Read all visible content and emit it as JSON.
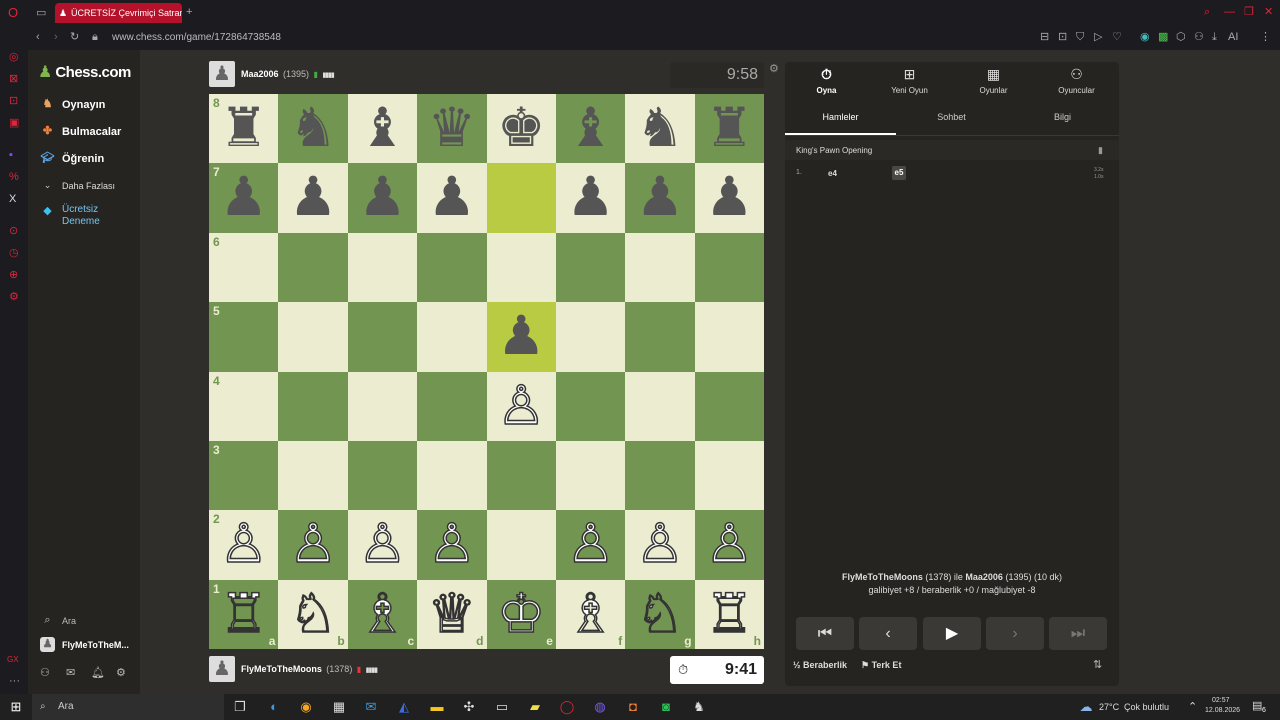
{
  "browser": {
    "tab_title": "ÜCRETSİZ Çevrimiçi Satranç",
    "url": "www.chess.com/game/172864738548",
    "ai_label": "AI"
  },
  "sidebar": {
    "logo": "Chess.com",
    "items": [
      {
        "label": "Oynayın",
        "icon": "play-icon"
      },
      {
        "label": "Bulmacalar",
        "icon": "puzzle-icon"
      },
      {
        "label": "Öğrenin",
        "icon": "learn-icon"
      },
      {
        "label": "Daha Fazlası",
        "icon": "chevron-down-icon"
      },
      {
        "label": "Ücretsiz Deneme",
        "icon": "diamond-icon"
      }
    ],
    "search_label": "Ara",
    "user_label": "FlyMeToTheM..."
  },
  "top_player": {
    "name": "Maa2006",
    "rating": "(1395)",
    "clock": "9:58"
  },
  "bottom_player": {
    "name": "FlyMeToTheMoons",
    "rating": "(1378)",
    "clock": "9:41"
  },
  "board": {
    "ranks": [
      "8",
      "7",
      "6",
      "5",
      "4",
      "3",
      "2",
      "1"
    ],
    "files": [
      "a",
      "b",
      "c",
      "d",
      "e",
      "f",
      "g",
      "h"
    ],
    "position": [
      [
        "♜",
        "♞",
        "♝",
        "♛",
        "♚",
        "♝",
        "♞",
        "♜"
      ],
      [
        "♟",
        "♟",
        "♟",
        "♟",
        "",
        "♟",
        "♟",
        "♟"
      ],
      [
        "",
        "",
        "",
        "",
        "",
        "",
        "",
        ""
      ],
      [
        "",
        "",
        "",
        "",
        "♟",
        "",
        "",
        ""
      ],
      [
        "",
        "",
        "",
        "",
        "♙",
        "",
        "",
        ""
      ],
      [
        "",
        "",
        "",
        "",
        "",
        "",
        "",
        ""
      ],
      [
        "♙",
        "♙",
        "♙",
        "♙",
        "",
        "♙",
        "♙",
        "♙"
      ],
      [
        "♖",
        "♘",
        "♗",
        "♕",
        "♔",
        "♗",
        "♘",
        "♖"
      ]
    ],
    "highlight": [
      "e7",
      "e5"
    ]
  },
  "panel": {
    "tabs": [
      {
        "label": "Oyna",
        "icon": "stopwatch-icon"
      },
      {
        "label": "Yeni Oyun",
        "icon": "plus-icon"
      },
      {
        "label": "Oyunlar",
        "icon": "board-icon"
      },
      {
        "label": "Oyuncular",
        "icon": "players-icon"
      }
    ],
    "subtabs": [
      "Hamleler",
      "Sohbet",
      "Bilgi"
    ],
    "opening": "King's Pawn Opening",
    "moves": [
      {
        "num": "1.",
        "white": "e4",
        "black": "e5",
        "t1": "3.2s",
        "t2": "1.0s"
      }
    ],
    "summary_line1_a": "FlyMeToTheMoons",
    "summary_line1_b": "(1378) ile",
    "summary_line1_c": "Maa2006",
    "summary_line1_d": "(1395) (10 dk)",
    "summary_line2": "galibiyet +8 / beraberlik +0 / mağlubiyet -8",
    "draw_label": "Beraberlik",
    "draw_icon": "½",
    "resign_label": "Terk Et"
  },
  "taskbar": {
    "search": "Ara",
    "weather": "27°C",
    "weather_desc": "Çok bulutlu",
    "time": "02:57",
    "date": "12.08.2026",
    "notif_count": "6"
  }
}
